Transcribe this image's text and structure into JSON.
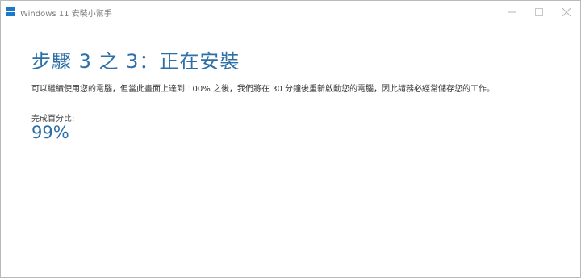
{
  "window": {
    "title": "Windows 11 安裝小幫手",
    "icon": "windows-logo-icon",
    "controls": [
      "minimize-icon",
      "maximize-icon",
      "close-icon"
    ]
  },
  "main": {
    "heading": "步驟 3 之 3：正在安裝",
    "description": "可以繼續使用您的電腦，但當此畫面上達到 100% 之後，我們將在 30 分鐘後重新啟動您的電腦，因此請務必經常儲存您的工作。",
    "progress_label": "完成百分比:",
    "progress_value": "99%",
    "progress_fraction": 0.99
  },
  "colors": {
    "accent": "#2d6fa6",
    "windows_logo": "#1c79c9",
    "title_text": "#7a7a7a"
  }
}
